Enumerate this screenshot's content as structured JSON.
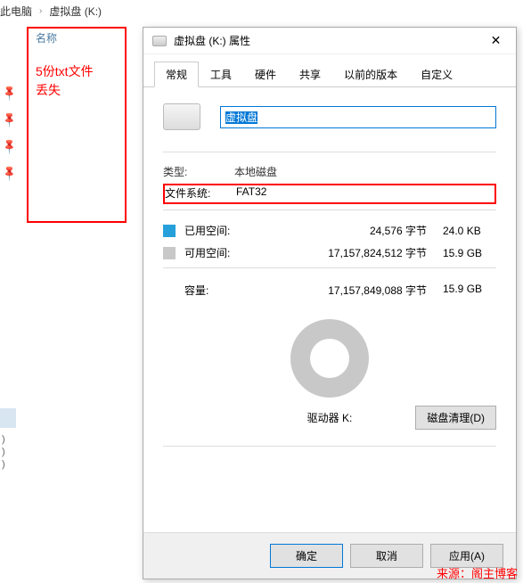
{
  "breadcrumb": {
    "item1": "此电脑",
    "item2": "虚拟盘 (K:)"
  },
  "column_header": "名称",
  "annotation": {
    "line1": "5份txt文件",
    "line2": "丢失"
  },
  "dialog": {
    "title": "虚拟盘 (K:) 属性",
    "tabs": {
      "general": "常规",
      "tools": "工具",
      "hardware": "硬件",
      "sharing": "共享",
      "prev": "以前的版本",
      "custom": "自定义"
    },
    "name_value": "虚拟盘",
    "type_label": "类型:",
    "type_value": "本地磁盘",
    "fs_label": "文件系统:",
    "fs_value": "FAT32",
    "used_label": "已用空间:",
    "used_bytes": "24,576 字节",
    "used_human": "24.0 KB",
    "free_label": "可用空间:",
    "free_bytes": "17,157,824,512 字节",
    "free_human": "15.9 GB",
    "capacity_label": "容量:",
    "capacity_bytes": "17,157,849,088 字节",
    "capacity_human": "15.9 GB",
    "drive_label": "驱动器 K:",
    "cleanup": "磁盘清理(D)",
    "ok": "确定",
    "cancel": "取消",
    "apply": "应用(A)"
  },
  "watermark": "来源：阁主博客"
}
